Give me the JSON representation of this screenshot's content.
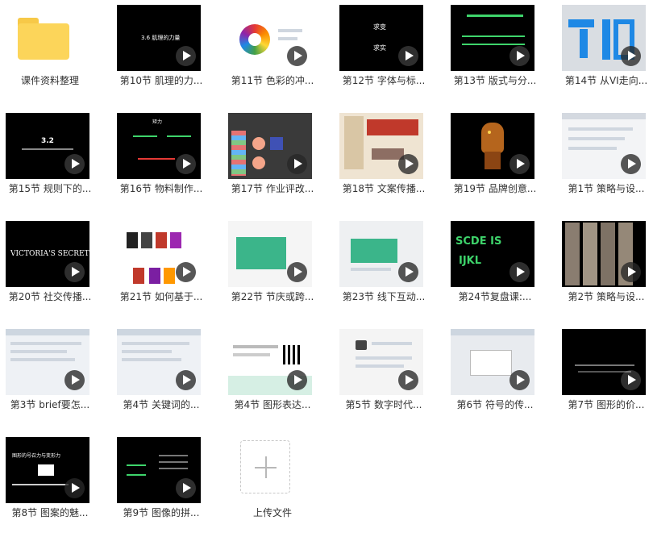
{
  "folder": {
    "label": "课件资料整理",
    "icon": "folder-icon"
  },
  "upload": {
    "label": "上传文件",
    "icon": "plus-icon"
  },
  "videos": [
    {
      "label": "第10节 肌理的力...",
      "thumb_text": [
        "3.6 肌理的力量"
      ]
    },
    {
      "label": "第11节 色彩的冲..."
    },
    {
      "label": "第12节 字体与标...",
      "thumb_text": [
        "求变",
        "求实"
      ]
    },
    {
      "label": "第13节 版式与分..."
    },
    {
      "label": "第14节 从VI走向..."
    },
    {
      "label": "第15节 规则下的...",
      "thumb_text": [
        "3.2"
      ]
    },
    {
      "label": "第16节 物料制作...",
      "thumb_text": [
        "矩力"
      ]
    },
    {
      "label": "第17节 作业评改..."
    },
    {
      "label": "第18节 文案传播..."
    },
    {
      "label": "第19节 品牌创意..."
    },
    {
      "label": "第1节 策略与设..."
    },
    {
      "label": "第20节 社交传播...",
      "thumb_text": [
        "VICTORIA'S SECRET"
      ]
    },
    {
      "label": "第21节 如何基于..."
    },
    {
      "label": "第22节 节庆或跨..."
    },
    {
      "label": "第23节 线下互动..."
    },
    {
      "label": "第24节复盘课:...",
      "thumb_text": [
        "SCDE IS",
        "IJKL"
      ]
    },
    {
      "label": "第2节 策略与设..."
    },
    {
      "label": "第3节 brief要怎..."
    },
    {
      "label": "第4节 关键词的..."
    },
    {
      "label": "第4节 图形表达..."
    },
    {
      "label": "第5节 数字时代..."
    },
    {
      "label": "第6节 符号的传..."
    },
    {
      "label": "第7节 图形的价..."
    },
    {
      "label": "第8节 图案的魅...",
      "thumb_text": [
        "图形的号召力与变形力"
      ]
    },
    {
      "label": "第9节 图像的拼..."
    }
  ]
}
